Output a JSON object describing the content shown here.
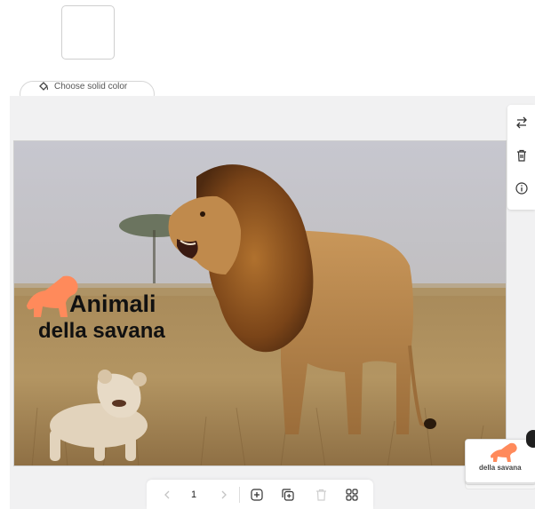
{
  "background_panel": {
    "solid_color_button_label": "Choose solid color",
    "icons": {
      "fill_icon": "paint-bucket-icon"
    }
  },
  "side_toolbar": {
    "icons": [
      "swap-icon",
      "trash-icon",
      "info-icon"
    ]
  },
  "slide": {
    "title_line1": "Animali",
    "title_line2": "della savana",
    "colors": {
      "title": "#111111",
      "accent_animal": "#ff8a5b"
    }
  },
  "bottom_bar": {
    "page_number": "1",
    "icons": [
      "chevron-left-icon",
      "chevron-right-icon",
      "add-page-icon",
      "duplicate-page-icon",
      "delete-page-icon",
      "grid-view-icon"
    ]
  },
  "thumbnail": {
    "title": "della savana"
  }
}
